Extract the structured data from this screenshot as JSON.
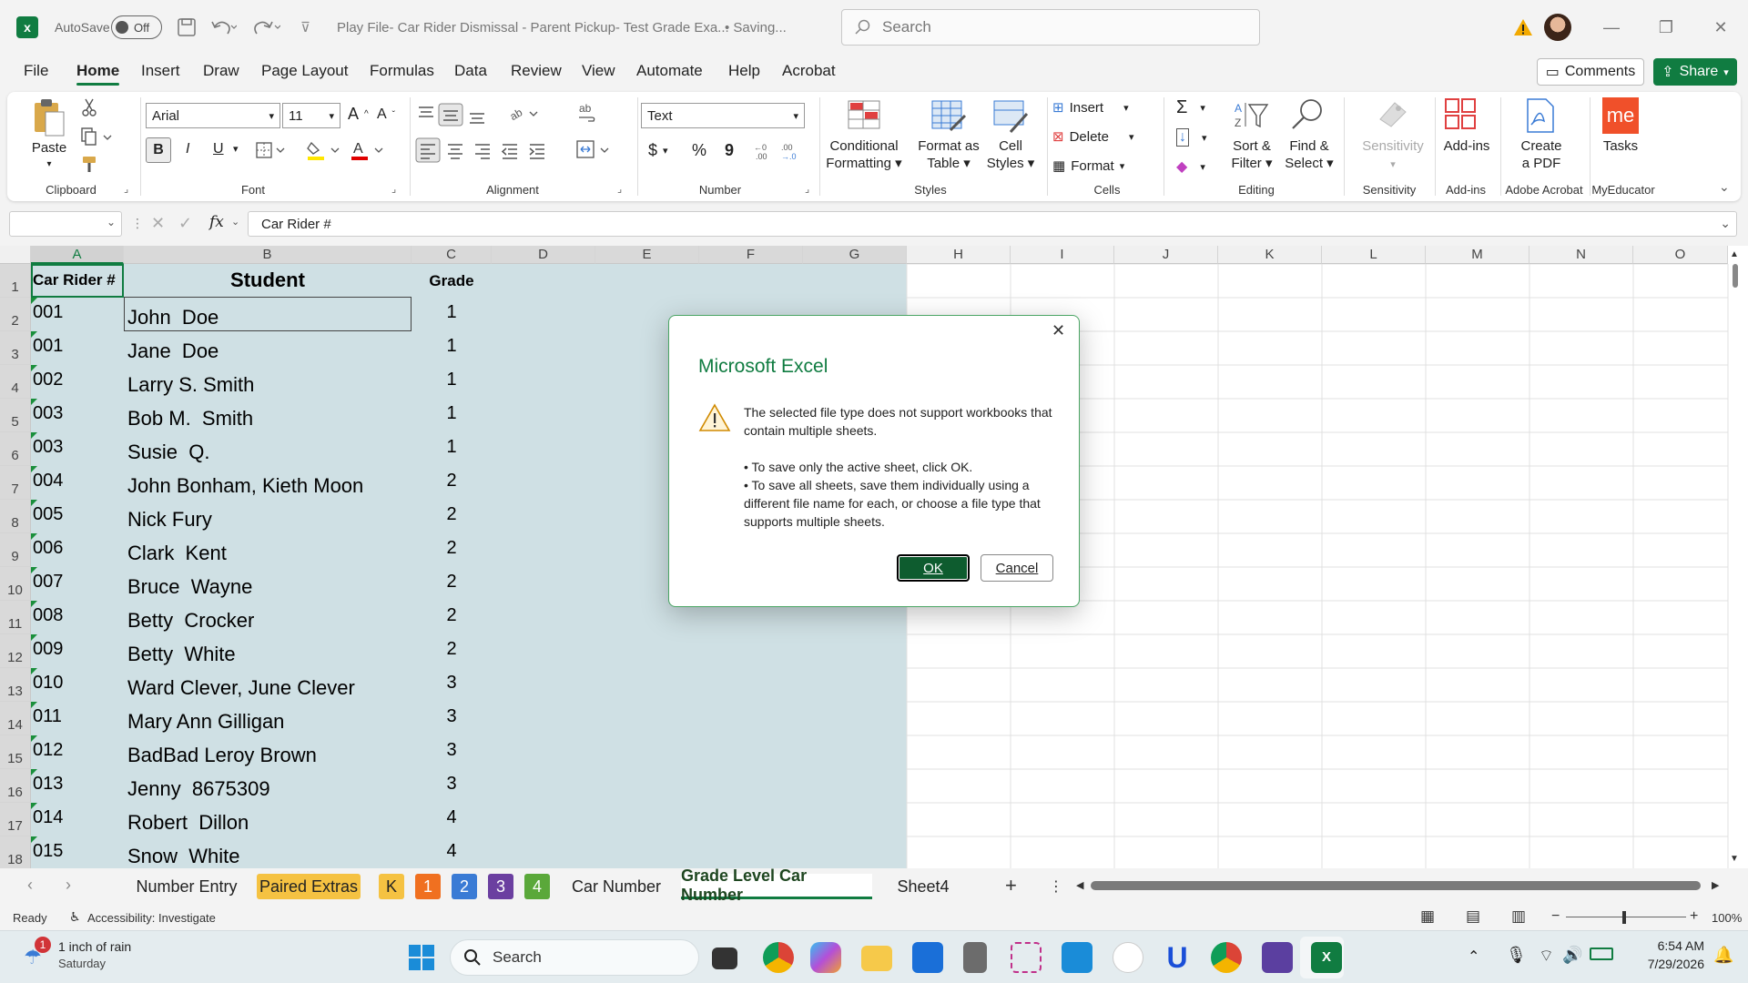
{
  "titlebar": {
    "autosave_label": "AutoSave",
    "autosave_state": "Off",
    "document_title": "Play File- Car Rider Dismissal - Parent Pickup- Test Grade Exa...",
    "save_status": "• Saving...",
    "search_placeholder": "Search"
  },
  "menu": [
    "File",
    "Home",
    "Insert",
    "Draw",
    "Page Layout",
    "Formulas",
    "Data",
    "Review",
    "View",
    "Automate",
    "Help",
    "Acrobat"
  ],
  "menu_active": "Home",
  "comments_label": "Comments",
  "share_label": "Share",
  "ribbon": {
    "clipboard": {
      "paste": "Paste",
      "label": "Clipboard"
    },
    "font": {
      "name": "Arial",
      "size": "11",
      "label": "Font",
      "bold": "B",
      "italic": "I",
      "underline": "U"
    },
    "alignment": {
      "label": "Alignment"
    },
    "number": {
      "format": "Text",
      "label": "Number",
      "currency": "$",
      "percent": "%",
      "comma": "9"
    },
    "styles": {
      "conditional": [
        "Conditional",
        "Formatting"
      ],
      "format_table": [
        "Format as",
        "Table"
      ],
      "cell_styles": [
        "Cell",
        "Styles"
      ],
      "label": "Styles"
    },
    "cells": {
      "insert": "Insert",
      "delete": "Delete",
      "format": "Format",
      "label": "Cells"
    },
    "editing": {
      "sort": [
        "Sort &",
        "Filter"
      ],
      "find": [
        "Find &",
        "Select"
      ],
      "label": "Editing"
    },
    "sensitivity": {
      "button": "Sensitivity",
      "label": "Sensitivity"
    },
    "addins": {
      "button": "Add-ins",
      "label": "Add-ins"
    },
    "acrobat": {
      "button": [
        "Create",
        "a PDF"
      ],
      "label": "Adobe Acrobat"
    },
    "myeducator": {
      "button": "Tasks",
      "logo": "me",
      "label": "MyEducator"
    }
  },
  "formula_bar": {
    "name_box": "",
    "formula": "Car Rider #",
    "fx": "fx"
  },
  "columns": [
    "A",
    "B",
    "C",
    "D",
    "E",
    "F",
    "G",
    "H",
    "I",
    "J",
    "K",
    "L",
    "M",
    "N",
    "O"
  ],
  "header_row": {
    "a": "Car Rider #",
    "b": "Student",
    "c": "Grade"
  },
  "rows": [
    {
      "n": "1"
    },
    {
      "n": "2",
      "a": "001",
      "b": "John  Doe",
      "c": "1"
    },
    {
      "n": "3",
      "a": "001",
      "b": "Jane  Doe",
      "c": "1"
    },
    {
      "n": "4",
      "a": "002",
      "b": "Larry S. Smith",
      "c": "1"
    },
    {
      "n": "5",
      "a": "003",
      "b": "Bob M.  Smith",
      "c": "1"
    },
    {
      "n": "6",
      "a": "003",
      "b": "Susie  Q.",
      "c": "1"
    },
    {
      "n": "7",
      "a": "004",
      "b": "John Bonham, Kieth Moon",
      "c": "2"
    },
    {
      "n": "8",
      "a": "005",
      "b": "Nick Fury",
      "c": "2"
    },
    {
      "n": "9",
      "a": "006",
      "b": "Clark  Kent",
      "c": "2"
    },
    {
      "n": "10",
      "a": "007",
      "b": "Bruce  Wayne",
      "c": "2"
    },
    {
      "n": "11",
      "a": "008",
      "b": "Betty  Crocker",
      "c": "2"
    },
    {
      "n": "12",
      "a": "009",
      "b": "Betty  White",
      "c": "2"
    },
    {
      "n": "13",
      "a": "010",
      "b": "Ward Clever, June Clever",
      "c": "3"
    },
    {
      "n": "14",
      "a": "011",
      "b": "Mary Ann Gilligan",
      "c": "3"
    },
    {
      "n": "15",
      "a": "012",
      "b": "BadBad Leroy Brown",
      "c": "3"
    },
    {
      "n": "16",
      "a": "013",
      "b": "Jenny  8675309",
      "c": "3"
    },
    {
      "n": "17",
      "a": "014",
      "b": "Robert  Dillon",
      "c": "4"
    },
    {
      "n": "18",
      "a": "015",
      "b": "Snow  White",
      "c": "4"
    }
  ],
  "sheet_tabs": [
    {
      "label": "Number Entry",
      "color": ""
    },
    {
      "label": "Paired Extras",
      "color": "#f5c242"
    },
    {
      "label": "K",
      "color": "#f5c242"
    },
    {
      "label": "1",
      "color": "#f07020"
    },
    {
      "label": "2",
      "color": "#3a7bd5"
    },
    {
      "label": "3",
      "color": "#6b3fa0"
    },
    {
      "label": "4",
      "color": "#5aa83a"
    },
    {
      "label": "Car Number",
      "color": ""
    },
    {
      "label": "Grade Level Car Number",
      "color": "",
      "active": true
    },
    {
      "label": "Sheet4",
      "color": ""
    }
  ],
  "status": {
    "ready": "Ready",
    "accessibility": "Accessibility: Investigate",
    "zoom": "100%"
  },
  "dialog": {
    "title": "Microsoft Excel",
    "message": "The selected file type does not support workbooks that contain multiple sheets.",
    "bullet1": "• To save only the active sheet, click OK.",
    "bullet2": "• To save all sheets, save them individually using a different file name for each, or choose a file type that supports multiple sheets.",
    "ok": "OK",
    "cancel": "Cancel"
  },
  "taskbar": {
    "weather_badge": "1",
    "weather_title": "1 inch of rain",
    "weather_sub": "Saturday",
    "search": "Search",
    "time": "6:54 AM",
    "date": "7/29/2026"
  },
  "colors": {
    "excel_green": "#107c41",
    "selection_fill": "#cfe0e4"
  }
}
